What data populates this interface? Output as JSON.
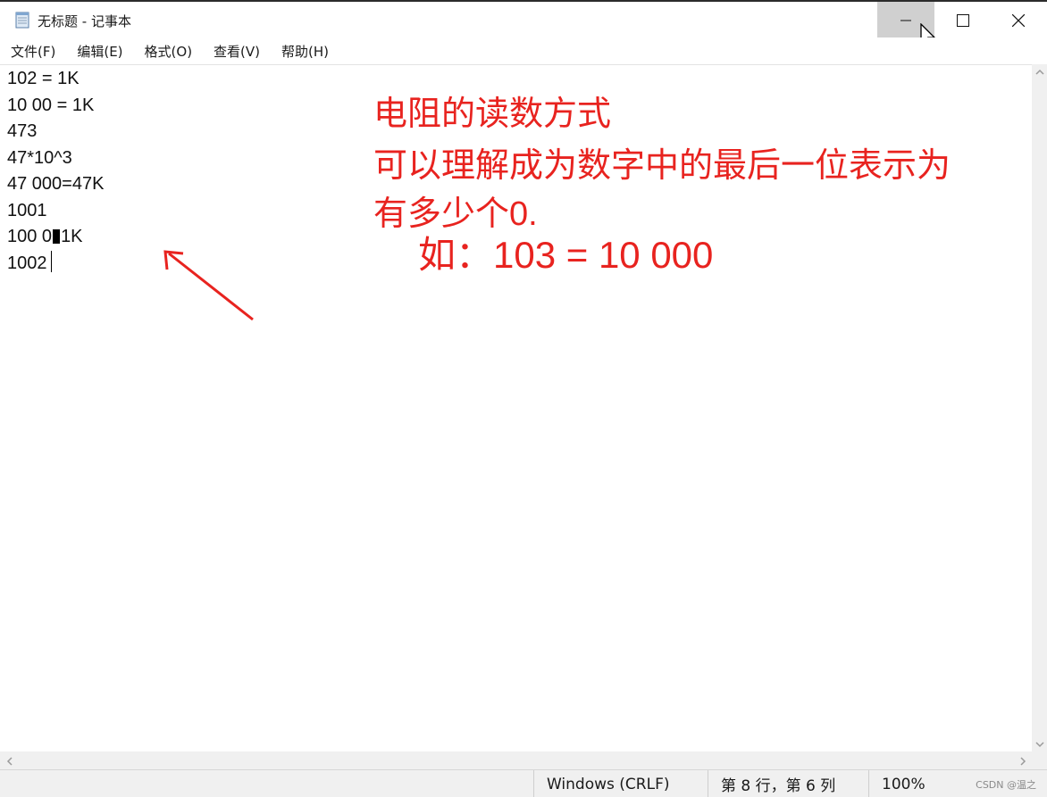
{
  "window": {
    "title": "无标题 - 记事本"
  },
  "caption": {
    "icons": [
      "minimize-icon",
      "maximize-icon",
      "close-icon"
    ]
  },
  "menu": [
    {
      "label": "文件(F)"
    },
    {
      "label": "编辑(E)"
    },
    {
      "label": "格式(O)"
    },
    {
      "label": "查看(V)"
    },
    {
      "label": "帮助(H)"
    }
  ],
  "editor": {
    "lines": [
      "102 = 1K",
      "10 00 = 1K",
      "473",
      "47*10^3",
      "47 000=47K",
      "1001",
      "1002"
    ],
    "line7_before": "100 0",
    "line7_after": "1K"
  },
  "annotation": {
    "lines": [
      "电阻的读数方式",
      "可以理解成为数字中的最后一位表示为",
      "有多少个0.",
      "如：103 = 10 000"
    ],
    "color": "#e8231f"
  },
  "status": {
    "encoding": "Windows (CRLF)",
    "position": "第 8 行，第 6 列",
    "zoom": "100%"
  },
  "watermark": "CSDN @温之"
}
